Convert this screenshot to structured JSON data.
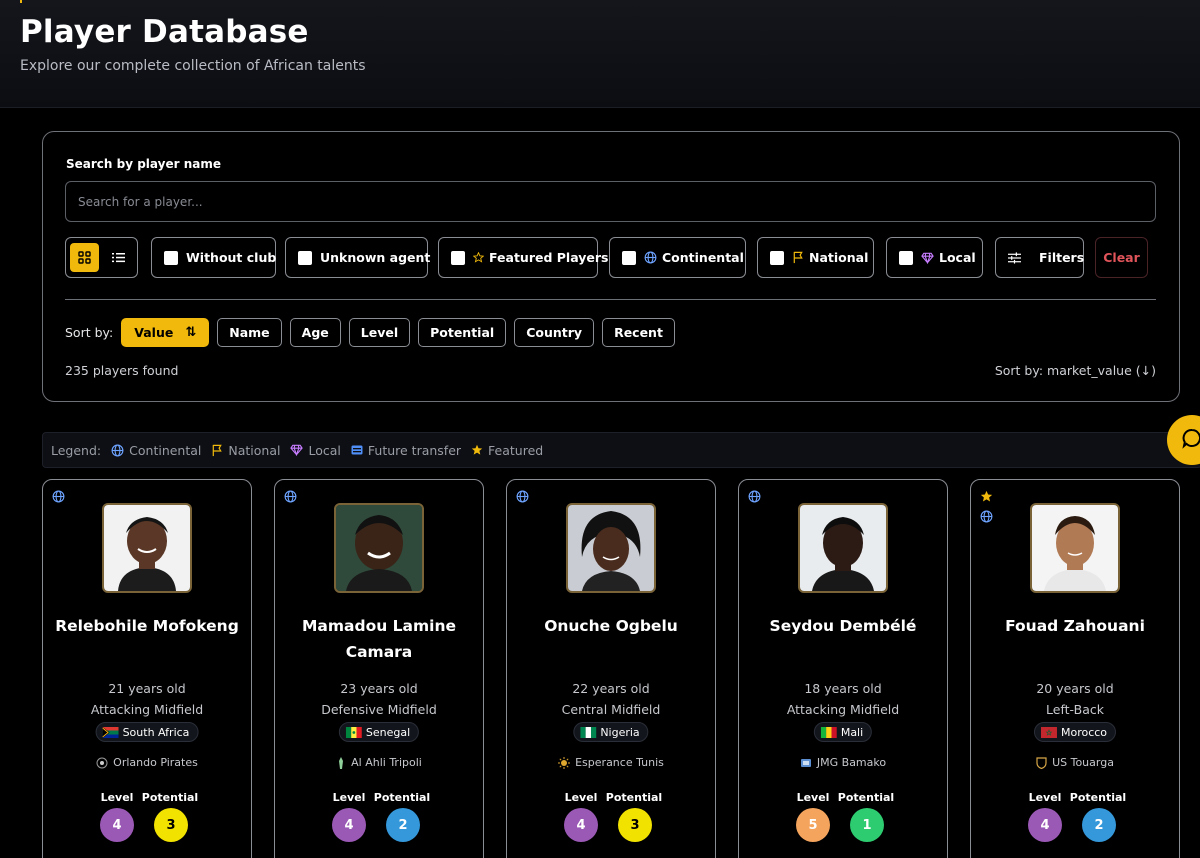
{
  "header": {
    "title": "Player Database",
    "subtitle": "Explore our complete collection of African talents"
  },
  "search": {
    "label": "Search by player name",
    "placeholder": "Search for a player..."
  },
  "filters": {
    "without_club": "Without club",
    "unknown_agent": "Unknown agent",
    "featured": "Featured Players",
    "continental": "Continental",
    "national": "National",
    "local": "Local",
    "filters_label": "Filters",
    "clear_label": "Clear"
  },
  "sort": {
    "label": "Sort by:",
    "options": [
      "Value",
      "Name",
      "Age",
      "Level",
      "Potential",
      "Country",
      "Recent"
    ],
    "active": "Value",
    "info": "Sort by: market_value (↓)"
  },
  "results": {
    "count_text": "235 players found"
  },
  "legend": {
    "label": "Legend:",
    "items": [
      "Continental",
      "National",
      "Local",
      "Future transfer",
      "Featured"
    ]
  },
  "colors": {
    "accent": "#f0b90b",
    "clear": "#e0545a",
    "level_purple": "#9b59b6",
    "potential_yellow": "#f2e200",
    "potential_blue": "#3498db",
    "level_orange": "#f5a45d",
    "potential_green": "#2ecc71"
  },
  "card_labels": {
    "level": "Level",
    "potential": "Potential"
  },
  "players": [
    {
      "name": "Relebohile Mofokeng",
      "age": "21 years old",
      "position": "Attacking Midfield",
      "country": "South Africa",
      "club": "Orlando Pirates",
      "level": 4,
      "potential": 3,
      "featured": false
    },
    {
      "name": "Mamadou Lamine Camara",
      "age": "23 years old",
      "position": "Defensive Midfield",
      "country": "Senegal",
      "club": "Al Ahli Tripoli",
      "level": 4,
      "potential": 2,
      "featured": false
    },
    {
      "name": "Onuche Ogbelu",
      "age": "22 years old",
      "position": "Central Midfield",
      "country": "Nigeria",
      "club": "Esperance Tunis",
      "level": 4,
      "potential": 3,
      "featured": false
    },
    {
      "name": "Seydou Dembélé",
      "age": "18 years old",
      "position": "Attacking Midfield",
      "country": "Mali",
      "club": "JMG Bamako",
      "level": 5,
      "potential": 1,
      "featured": false
    },
    {
      "name": "Fouad Zahouani",
      "age": "20 years old",
      "position": "Left-Back",
      "country": "Morocco",
      "club": "US Touarga",
      "level": 4,
      "potential": 2,
      "featured": true
    }
  ]
}
